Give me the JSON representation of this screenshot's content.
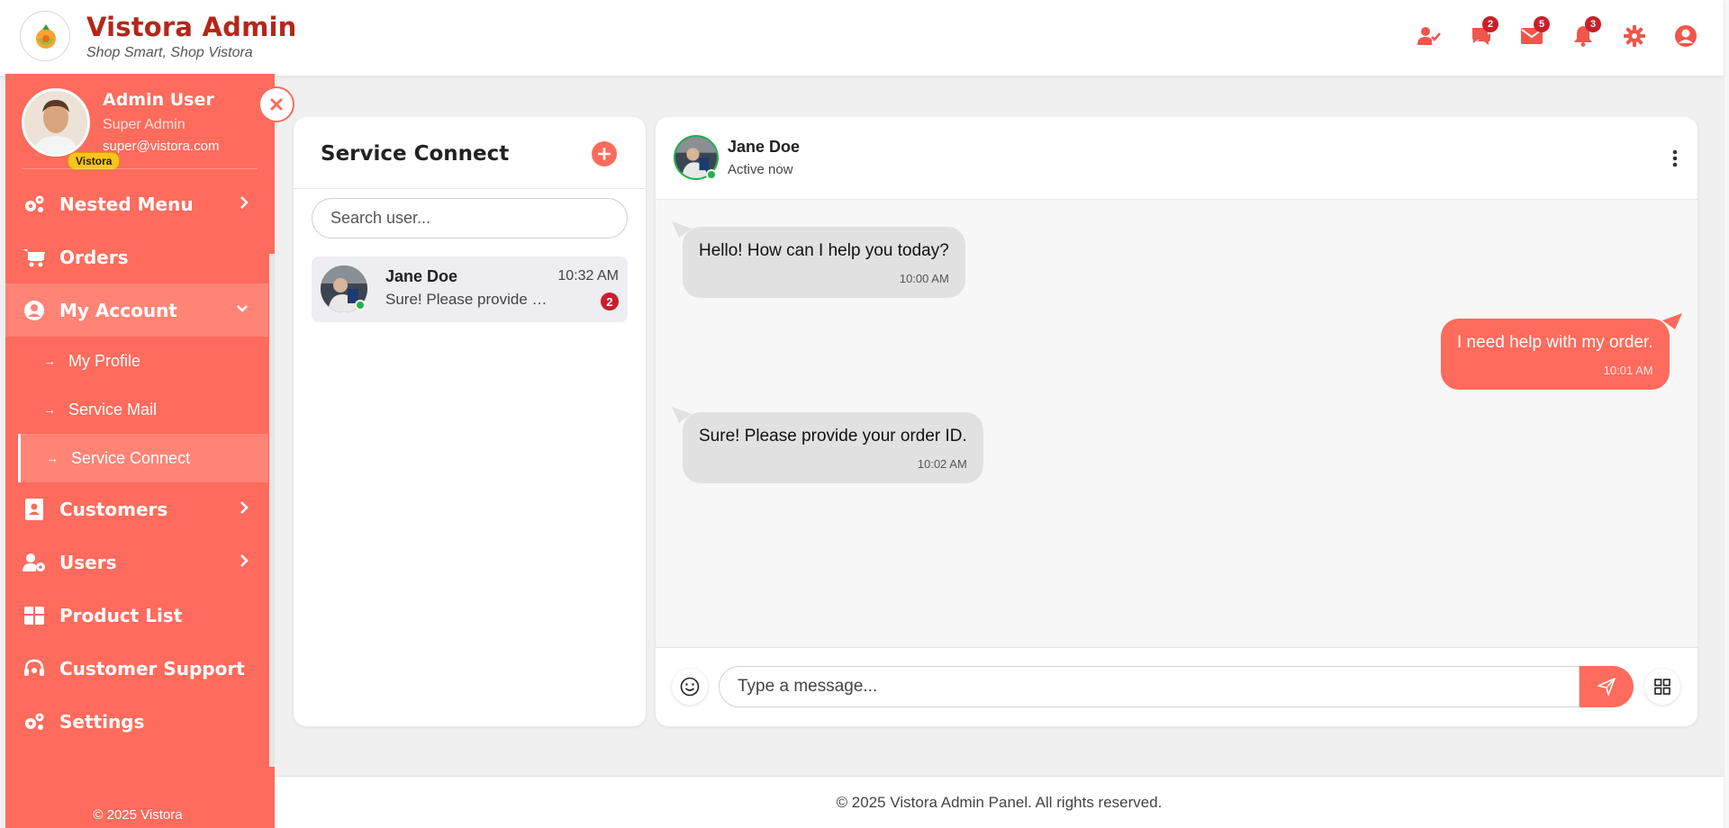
{
  "brand": {
    "title": "Vistora Admin",
    "tagline": "Shop Smart, Shop Vistora"
  },
  "header_icons": [
    {
      "name": "user-check-icon",
      "badge": null
    },
    {
      "name": "chat-icon",
      "badge": "2"
    },
    {
      "name": "mail-icon",
      "badge": "5"
    },
    {
      "name": "bell-icon",
      "badge": "3"
    },
    {
      "name": "gear-icon",
      "badge": null
    },
    {
      "name": "user-circle-icon",
      "badge": null
    }
  ],
  "sidebar": {
    "user": {
      "name": "Admin User",
      "role": "Super Admin",
      "email": "super@vistora.com",
      "tag": "Vistora"
    },
    "menu": {
      "nested": "Nested Menu",
      "orders": "Orders",
      "my_account": "My Account",
      "my_profile": "My Profile",
      "service_mail": "Service Mail",
      "service_connect": "Service Connect",
      "customers": "Customers",
      "users": "Users",
      "product_list": "Product List",
      "customer_support": "Customer Support",
      "settings": "Settings"
    },
    "footer": "© 2025 Vistora"
  },
  "conversations": {
    "title": "Service Connect",
    "search_placeholder": "Search user...",
    "items": [
      {
        "name": "Jane Doe",
        "time": "10:32 AM",
        "preview": "Sure! Please provide your order ID.",
        "unread": "2"
      }
    ]
  },
  "chat": {
    "contact_name": "Jane Doe",
    "status": "Active now",
    "messages": [
      {
        "direction": "in",
        "text": "Hello! How can I help you today?",
        "time": "10:00 AM"
      },
      {
        "direction": "out",
        "text": "I need help with my order.",
        "time": "10:01 AM"
      },
      {
        "direction": "in",
        "text": "Sure! Please provide your order ID.",
        "time": "10:02 AM"
      }
    ],
    "input_placeholder": "Type a message..."
  },
  "footer": "© 2025 Vistora Admin Panel. All rights reserved.",
  "colors": {
    "accent": "#ff6b5c",
    "brand_title": "#b4271b",
    "badge": "#c8202a",
    "online": "#22b14c"
  }
}
